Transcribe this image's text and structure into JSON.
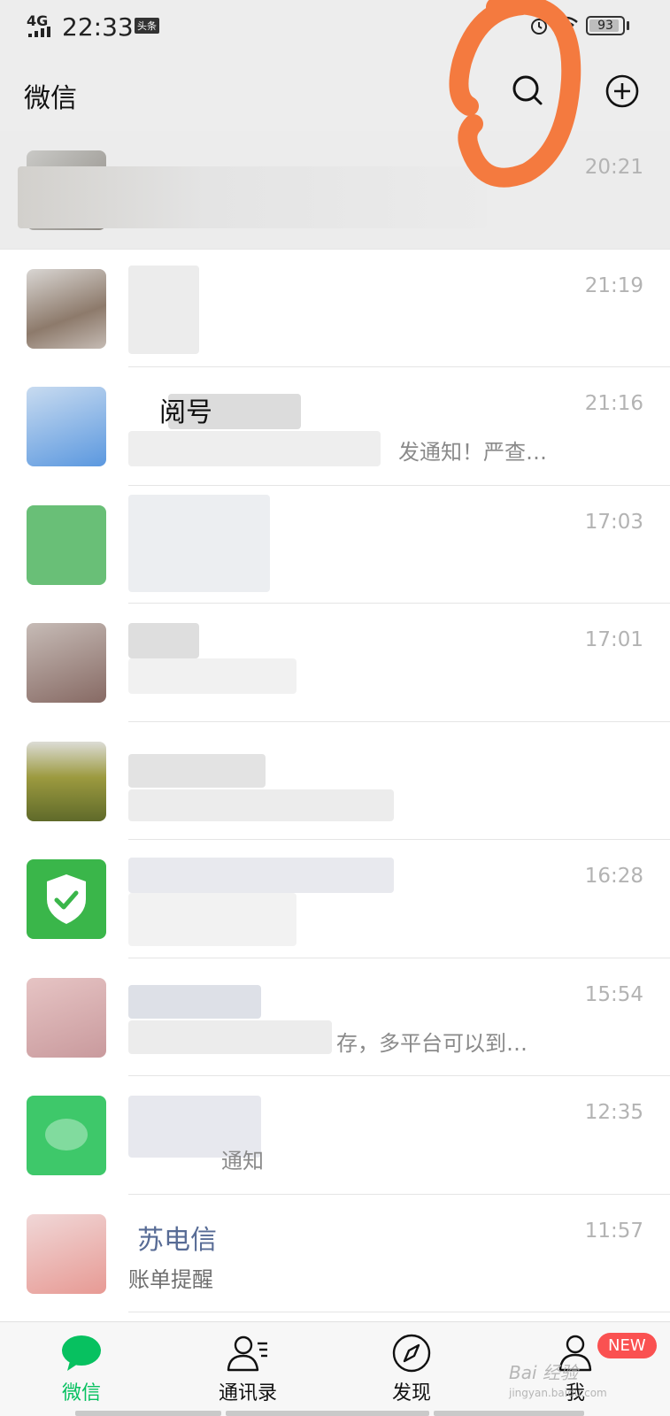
{
  "status_bar": {
    "network": "4G",
    "time": "22:33",
    "badge": "头条",
    "battery": "93",
    "battery_level": 93,
    "icons": [
      "signal-icon",
      "alarm-icon",
      "wifi-icon",
      "battery-icon"
    ]
  },
  "header": {
    "title": "微信",
    "icons": [
      "search-icon",
      "plus-circle-icon"
    ]
  },
  "chats": [
    {
      "name": "",
      "preview": "",
      "time": "20:21",
      "pinned": true
    },
    {
      "name": "",
      "preview": "",
      "time": "21:19"
    },
    {
      "name": "阅号",
      "preview": "发通知！严查…",
      "time": "21:16"
    },
    {
      "name": "",
      "preview": "",
      "time": "17:03"
    },
    {
      "name": "",
      "preview": "",
      "time": "17:01"
    },
    {
      "name": "",
      "preview": "",
      "time": ""
    },
    {
      "name": "",
      "preview": "",
      "time": "16:28"
    },
    {
      "name": "",
      "preview": "存，多平台可以到…",
      "time": "15:54"
    },
    {
      "name": "",
      "preview": "通知",
      "time": "12:35"
    },
    {
      "name": "苏电信",
      "preview": "账单提醒",
      "time": "11:57"
    }
  ],
  "tab_bar": {
    "tabs": [
      {
        "label": "微信",
        "icon": "chat-bubble-icon",
        "active": true
      },
      {
        "label": "通讯录",
        "icon": "contacts-icon"
      },
      {
        "label": "发现",
        "icon": "compass-icon"
      },
      {
        "label": "我",
        "icon": "person-icon"
      }
    ],
    "badge": "NEW",
    "watermark": "Bai 经验",
    "watermark_sub": "jingyan.baidu.com"
  },
  "colors": {
    "accent": "#07c160",
    "header_bg": "#ededed",
    "badge_red": "#fa5151",
    "annotation": "#f47a3f"
  }
}
